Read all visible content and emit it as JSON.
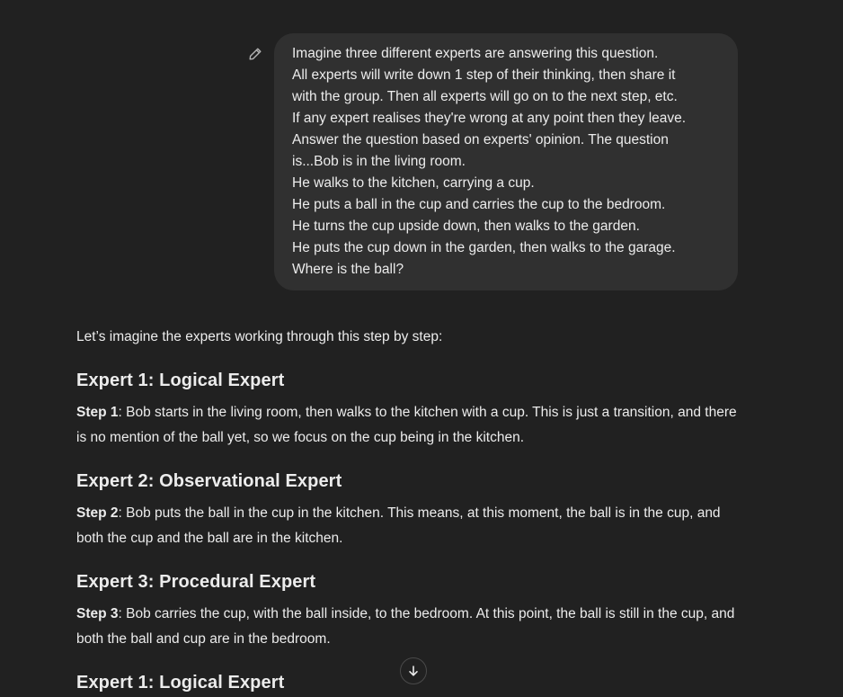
{
  "user_message": {
    "edit_icon": "pencil-icon",
    "lines": [
      "Imagine three different experts are answering this question.",
      "All experts will write down 1 step of their thinking, then share it",
      "with the group. Then all experts will go on to the next step, etc.",
      "If any expert realises they're wrong at any point then they leave.",
      "Answer the question based on experts' opinion. The question",
      "is...Bob is in the living room.",
      "He walks to the kitchen, carrying a cup.",
      "He puts a ball in the cup and carries the cup to the bedroom.",
      "He turns the cup upside down, then walks to the garden.",
      "He puts the cup down in the garden, then walks to the garage.",
      "Where is the ball?"
    ]
  },
  "response": {
    "intro": "Let’s imagine the experts working through this step by step:",
    "sections": [
      {
        "heading": "Expert 1: Logical Expert",
        "step_label": "Step 1",
        "step_text": ": Bob starts in the living room, then walks to the kitchen with a cup. This is just a transition, and there is no mention of the ball yet, so we focus on the cup being in the kitchen."
      },
      {
        "heading": "Expert 2: Observational Expert",
        "step_label": "Step 2",
        "step_text": ": Bob puts the ball in the cup in the kitchen. This means, at this moment, the ball is in the cup, and both the cup and the ball are in the kitchen."
      },
      {
        "heading": "Expert 3: Procedural Expert",
        "step_label": "Step 3",
        "step_text": ": Bob carries the cup, with the ball inside, to the bedroom. At this point, the ball is still in the cup, and both the ball and cup are in the bedroom."
      },
      {
        "heading": "Expert 1: Logical Expert"
      }
    ]
  },
  "scroll_button": {
    "icon": "arrow-down-icon"
  },
  "colors": {
    "background": "#212121",
    "bubble": "#303030",
    "text": "#ececec"
  }
}
